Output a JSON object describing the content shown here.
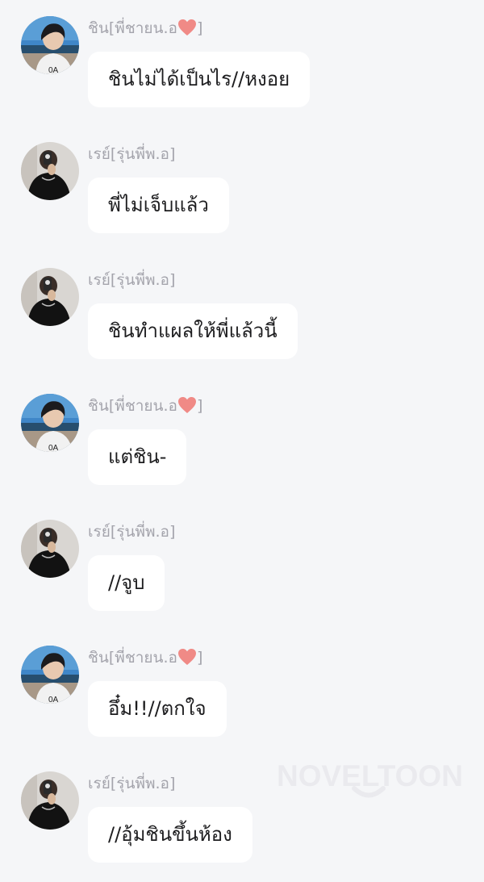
{
  "messages": [
    {
      "sender": "ชิน[พี่ชายน.อ",
      "has_heart": true,
      "avatar": "boy-seaside-avatar",
      "text": "ชินไม่ได้เป็นไร//หงอย"
    },
    {
      "sender": "เรย์[รุ่นพี่พ.อ]",
      "has_heart": false,
      "avatar": "mirror-selfie-avatar",
      "text": "พี่ไม่เจ็บแล้ว"
    },
    {
      "sender": "เรย์[รุ่นพี่พ.อ]",
      "has_heart": false,
      "avatar": "mirror-selfie-avatar",
      "text": "ชินทำแผลให้พี่แล้วนี้"
    },
    {
      "sender": "ชิน[พี่ชายน.อ",
      "has_heart": true,
      "avatar": "boy-seaside-avatar",
      "text": "แต่ชิน-"
    },
    {
      "sender": "เรย์[รุ่นพี่พ.อ]",
      "has_heart": false,
      "avatar": "mirror-selfie-avatar",
      "text": "//จูบ"
    },
    {
      "sender": "ชิน[พี่ชายน.อ",
      "has_heart": true,
      "avatar": "boy-seaside-avatar",
      "text": "อึ๋ม!!//ตกใจ"
    },
    {
      "sender": "เรย์[รุ่นพี่พ.อ]",
      "has_heart": false,
      "avatar": "mirror-selfie-avatar",
      "text": "//อุ้มชินขึ้นห้อง"
    }
  ],
  "heart_suffix": "]",
  "watermark": "NOVELTOON",
  "colors": {
    "background": "#f5f6f8",
    "bubble": "#ffffff",
    "sender_text": "#a4a4ac",
    "heart": "#f08a86"
  }
}
